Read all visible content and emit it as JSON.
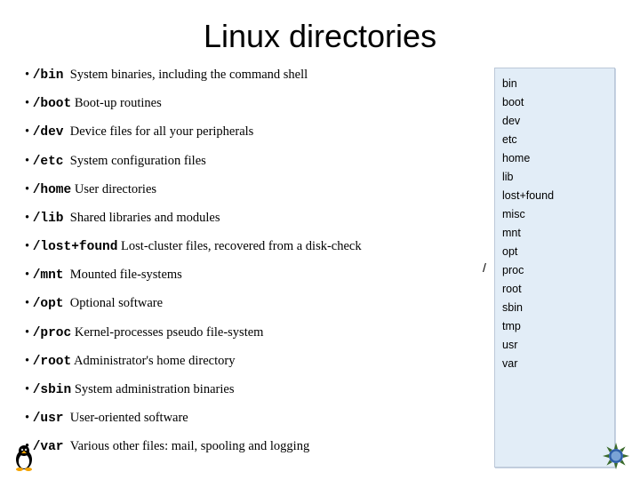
{
  "title": "Linux directories",
  "items": [
    {
      "dir": "/bin",
      "desc": "System binaries, including the command shell"
    },
    {
      "dir": "/boot",
      "desc": "Boot-up routines"
    },
    {
      "dir": "/dev",
      "desc": "Device files for all your peripherals"
    },
    {
      "dir": "/etc",
      "desc": "System configuration files"
    },
    {
      "dir": "/home",
      "desc": "User directories"
    },
    {
      "dir": "/lib",
      "desc": "Shared libraries and modules"
    },
    {
      "dir": "/lost+found",
      "desc": "Lost-cluster files, recovered from a disk-check"
    },
    {
      "dir": "/mnt",
      "desc": "Mounted file-systems"
    },
    {
      "dir": "/opt",
      "desc": "Optional software"
    },
    {
      "dir": "/proc",
      "desc": "Kernel-processes pseudo file-system"
    },
    {
      "dir": "/root",
      "desc": "Administrator's home directory"
    },
    {
      "dir": "/sbin",
      "desc": "System administration binaries"
    },
    {
      "dir": "/usr",
      "desc": "User-oriented software"
    },
    {
      "dir": "/var",
      "desc": "Various other files: mail, spooling and logging"
    }
  ],
  "tree": {
    "root": "/",
    "children": [
      "bin",
      "boot",
      "dev",
      "etc",
      "home",
      "lib",
      "lost+found",
      "misc",
      "mnt",
      "opt",
      "proc",
      "root",
      "sbin",
      "tmp",
      "usr",
      "var"
    ]
  }
}
